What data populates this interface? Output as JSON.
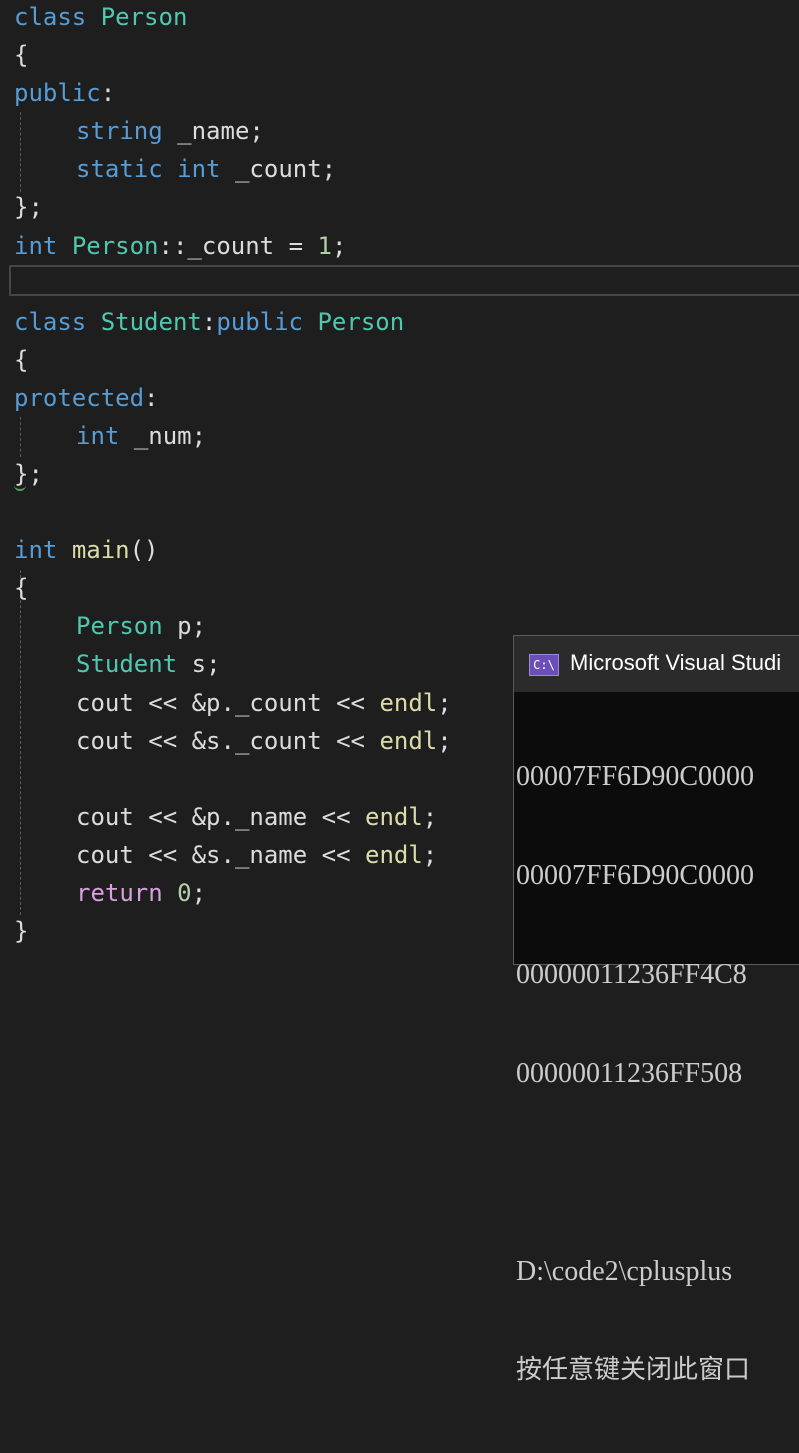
{
  "editor": {
    "lines": {
      "l1_kw": "class",
      "l1_name": "Person",
      "l2": "{",
      "l3_kw": "public",
      "l3_colon": ":",
      "l4_ty": "string",
      "l4_var": "_name",
      "l4_semi": ";",
      "l5_kw1": "static",
      "l5_kw2": "int",
      "l5_var": "_count",
      "l5_semi": ";",
      "l6": "};",
      "l7_kw": "int",
      "l7_ty": "Person",
      "l7_sep": "::",
      "l7_var": "_count",
      "l7_eq": " = ",
      "l7_num": "1",
      "l7_semi": ";",
      "l9_kw": "class",
      "l9_ty": "Student",
      "l9_colon": ":",
      "l9_kw2": "public",
      "l9_base": "Person",
      "l10": "{",
      "l11_kw": "protected",
      "l11_colon": ":",
      "l12_kw": "int",
      "l12_var": "_num",
      "l12_semi": ";",
      "l13": "};",
      "l15_kw": "int",
      "l15_fn": "main",
      "l15_paren": "()",
      "l16": "{",
      "l17_ty": "Person",
      "l17_var": "p",
      "l17_semi": ";",
      "l18_ty": "Student",
      "l18_var": "s",
      "l18_semi": ";",
      "l19_a": "cout",
      "l19_b": " << &",
      "l19_c": "p",
      "l19_d": ".",
      "l19_e": "_count",
      "l19_f": " << ",
      "l19_g": "endl",
      "l19_h": ";",
      "l20_a": "cout",
      "l20_b": " << &",
      "l20_c": "s",
      "l20_d": ".",
      "l20_e": "_count",
      "l20_f": " << ",
      "l20_g": "endl",
      "l20_h": ";",
      "l22_a": "cout",
      "l22_b": " << &",
      "l22_c": "p",
      "l22_d": ".",
      "l22_e": "_name",
      "l22_f": " << ",
      "l22_g": "endl",
      "l22_h": ";",
      "l23_a": "cout",
      "l23_b": " << &",
      "l23_c": "s",
      "l23_d": ".",
      "l23_e": "_name",
      "l23_f": " << ",
      "l23_g": "endl",
      "l23_h": ";",
      "l24_kw": "return",
      "l24_num": "0",
      "l24_semi": ";",
      "l25": "}"
    },
    "colors": {
      "keyword": "#569cd6",
      "type": "#4ec9b0",
      "function": "#dcdcaa",
      "control": "#d8a0df",
      "number": "#b5cea8",
      "text": "#dcdcdc"
    }
  },
  "console": {
    "icon": "console-app-icon",
    "icon_text": "C:\\",
    "title": "Microsoft Visual Studi",
    "output": [
      "00007FF6D90C0000",
      "00007FF6D90C0000",
      "00000011236FF4C8",
      "00000011236FF508",
      "",
      "D:\\code2\\cplusplus",
      "按任意键关闭此窗口"
    ]
  }
}
